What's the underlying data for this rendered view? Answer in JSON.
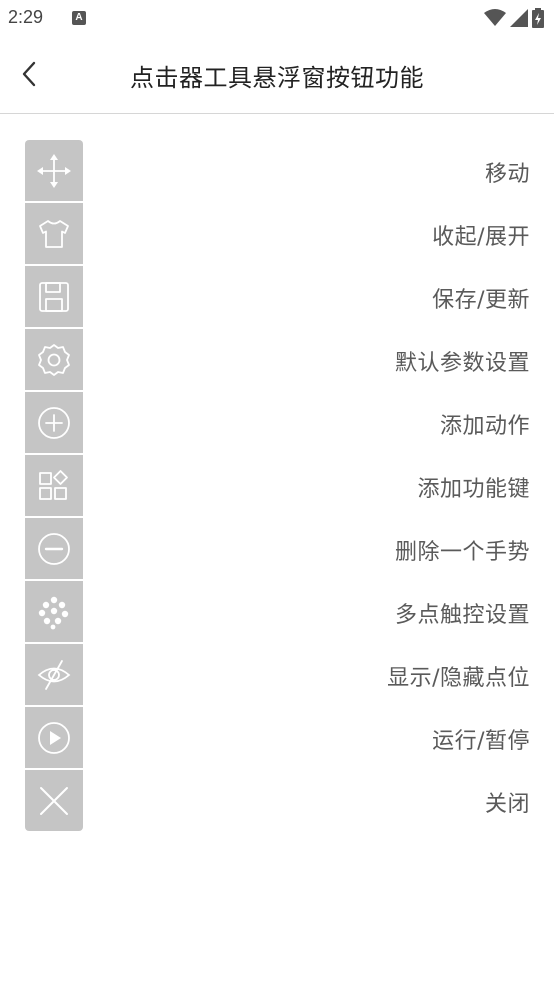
{
  "status_bar": {
    "time": "2:29",
    "notification_letter": "A"
  },
  "header": {
    "title": "点击器工具悬浮窗按钮功能"
  },
  "items": [
    {
      "icon": "move-icon",
      "label": "移动"
    },
    {
      "icon": "shirt-icon",
      "label": "收起/展开"
    },
    {
      "icon": "save-icon",
      "label": "保存/更新"
    },
    {
      "icon": "gear-icon",
      "label": "默认参数设置"
    },
    {
      "icon": "plus-circle-icon",
      "label": "添加动作"
    },
    {
      "icon": "apps-icon",
      "label": "添加功能键"
    },
    {
      "icon": "minus-circle-icon",
      "label": "删除一个手势"
    },
    {
      "icon": "multi-dot-icon",
      "label": "多点触控设置"
    },
    {
      "icon": "eye-off-icon",
      "label": "显示/隐藏点位"
    },
    {
      "icon": "play-icon",
      "label": "运行/暂停"
    },
    {
      "icon": "close-icon",
      "label": "关闭"
    }
  ],
  "colors": {
    "toolbar_bg": "#c5c5c5",
    "icon": "#ffffff",
    "label_text": "#5a5a5a"
  }
}
